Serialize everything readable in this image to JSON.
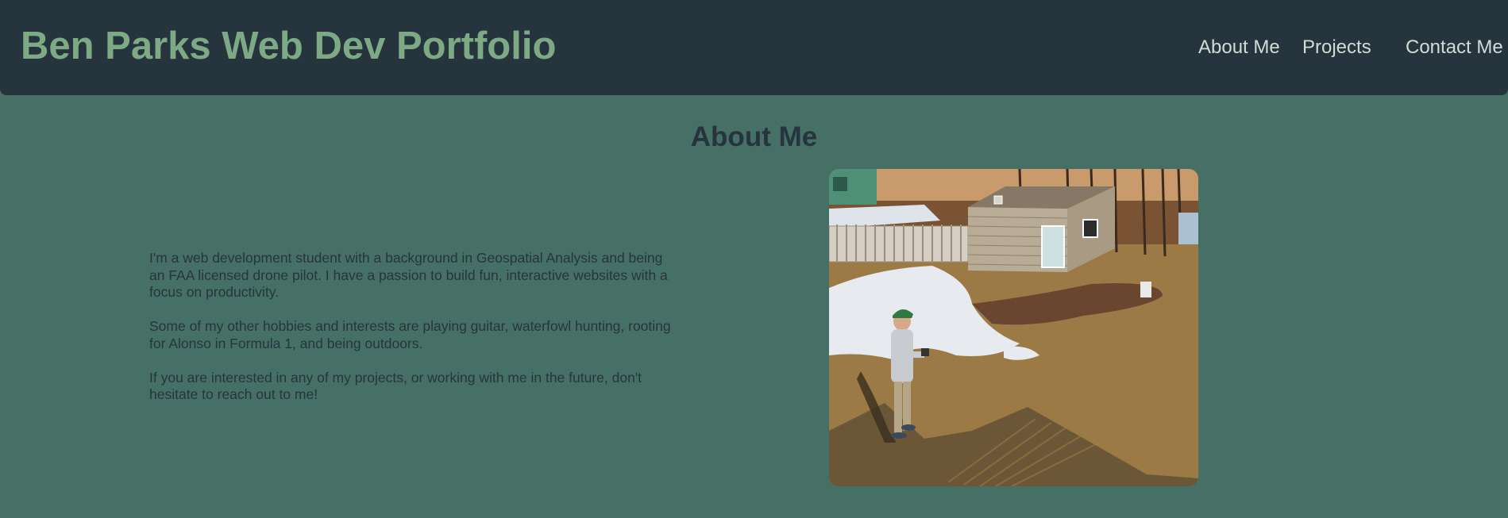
{
  "header": {
    "title": "Ben Parks Web Dev Portfolio",
    "nav": [
      {
        "label": "About Me"
      },
      {
        "label": "Projects"
      },
      {
        "label": "Contact Me"
      }
    ]
  },
  "about": {
    "heading": "About Me",
    "paragraphs": [
      "I'm a web development student with a background in Geospatial Analysis and being an FAA licensed drone pilot. I have a passion to build fun, interactive websites with a focus on productivity.",
      "Some of my other hobbies and interests are playing guitar, waterfowl hunting, rooting for Alonso in Formula 1, and being outdoors.",
      "If you are interested in any of my projects, or working with me in the future, don't hesitate to reach out to me!"
    ]
  },
  "colors": {
    "page_background": "#467066",
    "header_background": "#26353d",
    "title_color": "#7daa85",
    "nav_text": "#d3dbd6",
    "body_text": "#26353d"
  }
}
